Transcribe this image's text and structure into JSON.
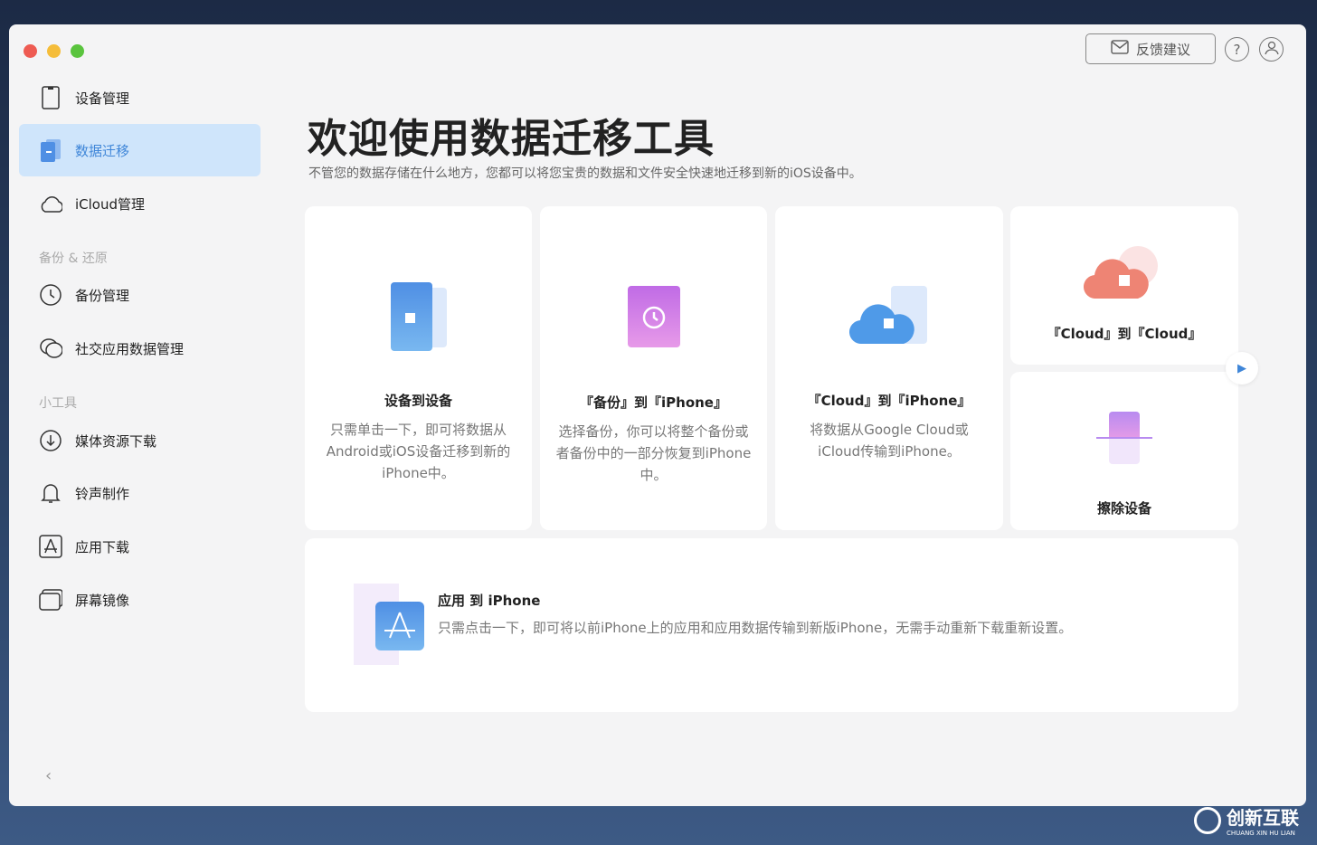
{
  "colors": {
    "accent": "#3f86d8",
    "close": "#ee5b52",
    "minimize": "#f5bd3a",
    "maximize": "#5ac43e"
  },
  "sidebar": {
    "items": [
      {
        "label": "设备管理",
        "icon": "phone-icon"
      },
      {
        "label": "数据迁移",
        "icon": "transfer-icon"
      },
      {
        "label": "iCloud管理",
        "icon": "cloud-icon"
      }
    ],
    "section_backup": "备份 & 还原",
    "backup_items": [
      {
        "label": "备份管理",
        "icon": "history-icon"
      },
      {
        "label": "社交应用数据管理",
        "icon": "chat-icon"
      }
    ],
    "section_tools": "小工具",
    "tool_items": [
      {
        "label": "媒体资源下载",
        "icon": "download-icon"
      },
      {
        "label": "铃声制作",
        "icon": "bell-icon"
      },
      {
        "label": "应用下载",
        "icon": "appstore-icon"
      },
      {
        "label": "屏幕镜像",
        "icon": "mirror-icon"
      }
    ],
    "collapse": "‹"
  },
  "header": {
    "feedback": "反馈建议",
    "help": "?"
  },
  "main": {
    "title": "欢迎使用数据迁移工具",
    "subtitle": "不管您的数据存储在什么地方，您都可以将您宝贵的数据和文件安全快速地迁移到新的iOS设备中。",
    "cards": [
      {
        "title": "设备到设备",
        "desc": "只需单击一下，即可将数据从Android或iOS设备迁移到新的iPhone中。"
      },
      {
        "title": "『备份』到『iPhone』",
        "desc": "选择备份，你可以将整个备份或者备份中的一部分恢复到iPhone中。"
      },
      {
        "title": "『Cloud』到『iPhone』",
        "desc": "将数据从Google Cloud或iCloud传输到iPhone。"
      },
      {
        "title": "『Cloud』到『Cloud』"
      },
      {
        "title": "擦除设备"
      }
    ],
    "wide_card": {
      "title": "应用 到 iPhone",
      "desc": "只需点击一下，即可将以前iPhone上的应用和应用数据传输到新版iPhone，无需手动重新下载重新设置。"
    }
  },
  "watermark": {
    "text": "创新互联",
    "sub": "CHUANG XIN HU LIAN"
  }
}
